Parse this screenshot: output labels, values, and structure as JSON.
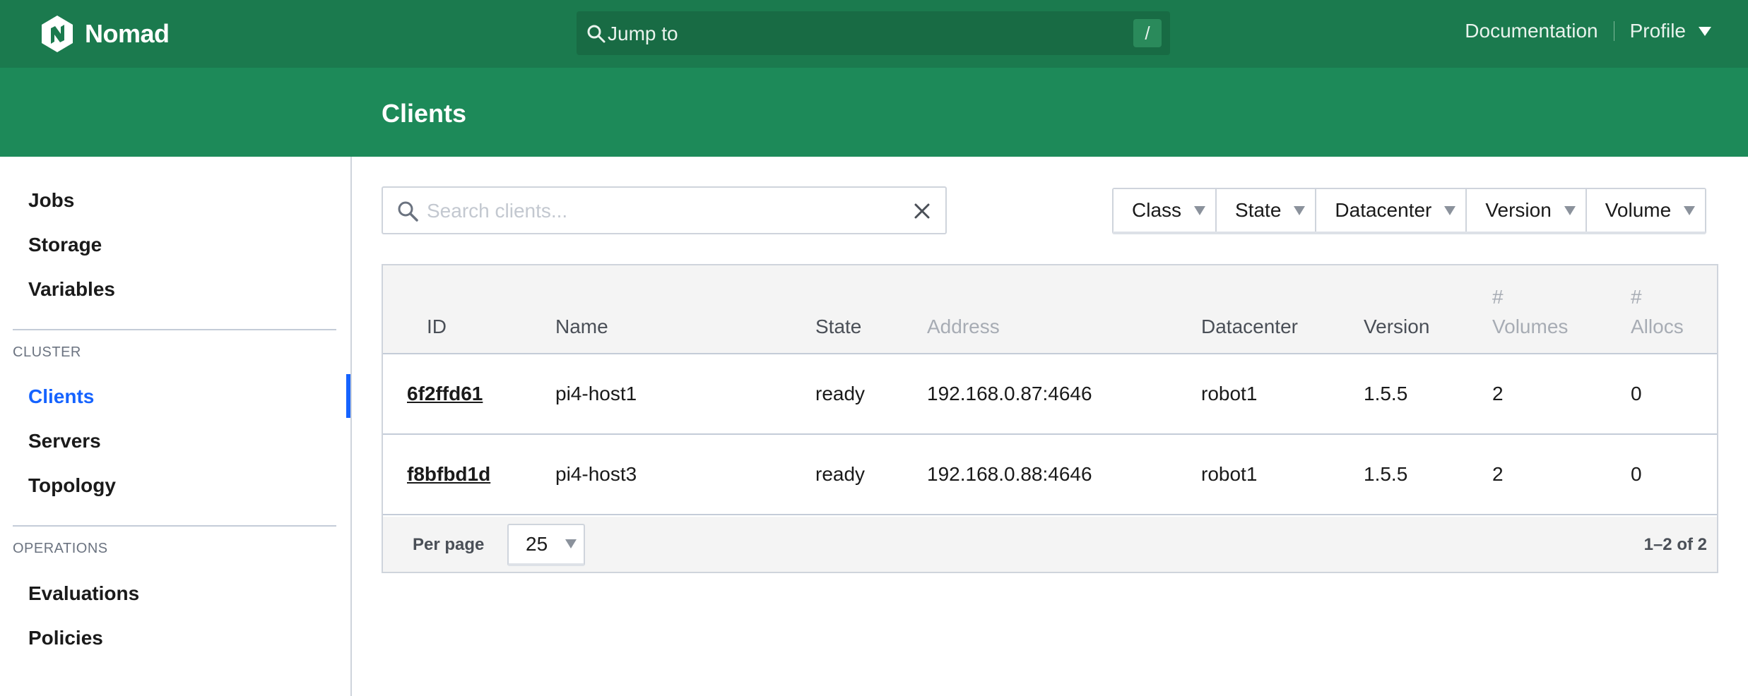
{
  "brand": {
    "name": "Nomad",
    "logo_icon": "nomad-logo-icon",
    "primary_color": "#1b7a4e",
    "secondary_color": "#1d8a59",
    "accent_color": "#1563ff"
  },
  "topnav": {
    "jump_placeholder": "Jump to",
    "jump_shortcut": "/",
    "documentation_label": "Documentation",
    "profile_label": "Profile"
  },
  "page": {
    "title": "Clients"
  },
  "sidebar": {
    "top_items": [
      {
        "label": "Jobs"
      },
      {
        "label": "Storage"
      },
      {
        "label": "Variables"
      }
    ],
    "cluster_section": "CLUSTER",
    "cluster_items": [
      {
        "label": "Clients",
        "active": true
      },
      {
        "label": "Servers"
      },
      {
        "label": "Topology"
      }
    ],
    "operations_section": "OPERATIONS",
    "operations_items": [
      {
        "label": "Evaluations"
      },
      {
        "label": "Policies"
      }
    ]
  },
  "search": {
    "placeholder": "Search clients...",
    "value": ""
  },
  "filters": [
    {
      "label": "Class"
    },
    {
      "label": "State"
    },
    {
      "label": "Datacenter"
    },
    {
      "label": "Version"
    },
    {
      "label": "Volume"
    }
  ],
  "table": {
    "columns": {
      "id": "ID",
      "name": "Name",
      "state": "State",
      "address": "Address",
      "datacenter": "Datacenter",
      "version": "Version",
      "volumes_hash": "#",
      "volumes": "Volumes",
      "allocs_hash": "#",
      "allocs": "Allocs"
    },
    "rows": [
      {
        "id": "6f2ffd61",
        "name": "pi4-host1",
        "state": "ready",
        "address": "192.168.0.87:4646",
        "datacenter": "robot1",
        "version": "1.5.5",
        "volumes": "2",
        "allocs": "0"
      },
      {
        "id": "f8bfbd1d",
        "name": "pi4-host3",
        "state": "ready",
        "address": "192.168.0.88:4646",
        "datacenter": "robot1",
        "version": "1.5.5",
        "volumes": "2",
        "allocs": "0"
      }
    ],
    "per_page_label": "Per page",
    "per_page_value": "25",
    "pagination_text": "1–2 of 2"
  }
}
